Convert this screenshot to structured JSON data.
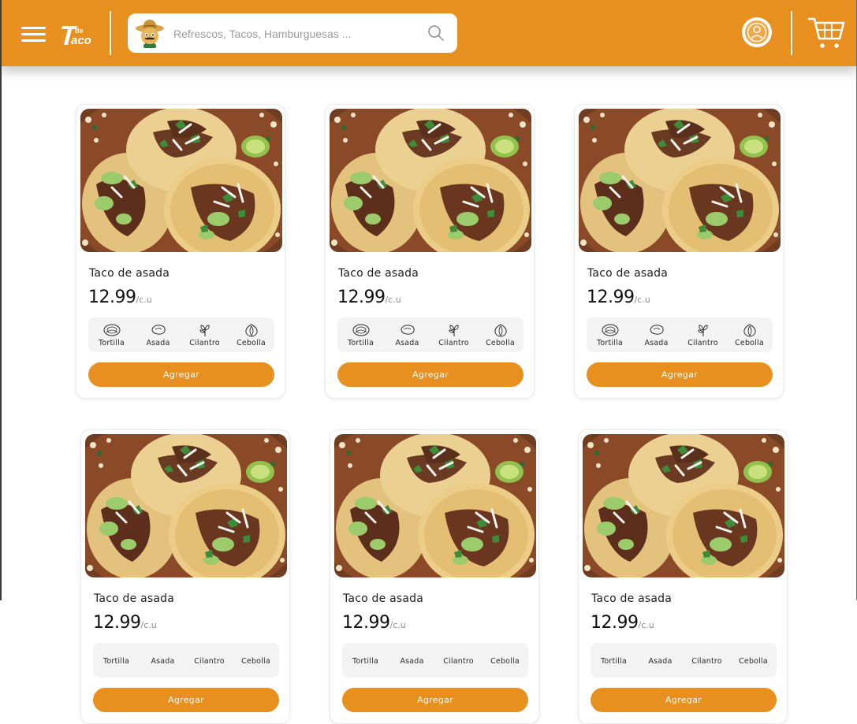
{
  "header": {
    "menu_icon": "hamburger-menu-icon",
    "logo_text": "Taco",
    "logo_small_text": "de",
    "search": {
      "placeholder": "Refrescos, Tacos, Hamburguesas ...",
      "value": "",
      "mascot_icon": "taco-mascot-icon",
      "search_icon": "magnifier-icon"
    },
    "user_icon": "user-account-icon",
    "cart_icon": "shopping-cart-icon"
  },
  "colors": {
    "primary": "#e8901f",
    "card_background": "#ffffff",
    "ingredient_background": "#f3f3f3"
  },
  "products": [
    {
      "name": "Taco de asada",
      "price": "12.99",
      "unit": "/c.u",
      "ingredients": [
        {
          "label": "Tortilla",
          "icon": "tortilla-icon"
        },
        {
          "label": "Asada",
          "icon": "steak-icon"
        },
        {
          "label": "Cilantro",
          "icon": "cilantro-icon"
        },
        {
          "label": "Cebolla",
          "icon": "onion-icon"
        }
      ],
      "button": "Agregar"
    },
    {
      "name": "Taco de asada",
      "price": "12.99",
      "unit": "/c.u",
      "ingredients": [
        {
          "label": "Tortilla",
          "icon": "tortilla-icon"
        },
        {
          "label": "Asada",
          "icon": "steak-icon"
        },
        {
          "label": "Cilantro",
          "icon": "cilantro-icon"
        },
        {
          "label": "Cebolla",
          "icon": "onion-icon"
        }
      ],
      "button": "Agregar"
    },
    {
      "name": "Taco de asada",
      "price": "12.99",
      "unit": "/c.u",
      "ingredients": [
        {
          "label": "Tortilla",
          "icon": "tortilla-icon"
        },
        {
          "label": "Asada",
          "icon": "steak-icon"
        },
        {
          "label": "Cilantro",
          "icon": "cilantro-icon"
        },
        {
          "label": "Cebolla",
          "icon": "onion-icon"
        }
      ],
      "button": "Agregar"
    },
    {
      "name": "Taco de asada",
      "price": "12.99",
      "unit": "/c.u",
      "ingredients": [
        {
          "label": "Tortilla",
          "icon": "tortilla-icon"
        },
        {
          "label": "Asada",
          "icon": "steak-icon"
        },
        {
          "label": "Cilantro",
          "icon": "cilantro-icon"
        },
        {
          "label": "Cebolla",
          "icon": "onion-icon"
        }
      ],
      "button": "Agregar"
    },
    {
      "name": "Taco de asada",
      "price": "12.99",
      "unit": "/c.u",
      "ingredients": [
        {
          "label": "Tortilla",
          "icon": "tortilla-icon"
        },
        {
          "label": "Asada",
          "icon": "steak-icon"
        },
        {
          "label": "Cilantro",
          "icon": "cilantro-icon"
        },
        {
          "label": "Cebolla",
          "icon": "onion-icon"
        }
      ],
      "button": "Agregar"
    },
    {
      "name": "Taco de asada",
      "price": "12.99",
      "unit": "/c.u",
      "ingredients": [
        {
          "label": "Tortilla",
          "icon": "tortilla-icon"
        },
        {
          "label": "Asada",
          "icon": "steak-icon"
        },
        {
          "label": "Cilantro",
          "icon": "cilantro-icon"
        },
        {
          "label": "Cebolla",
          "icon": "onion-icon"
        }
      ],
      "button": "Agregar"
    }
  ]
}
